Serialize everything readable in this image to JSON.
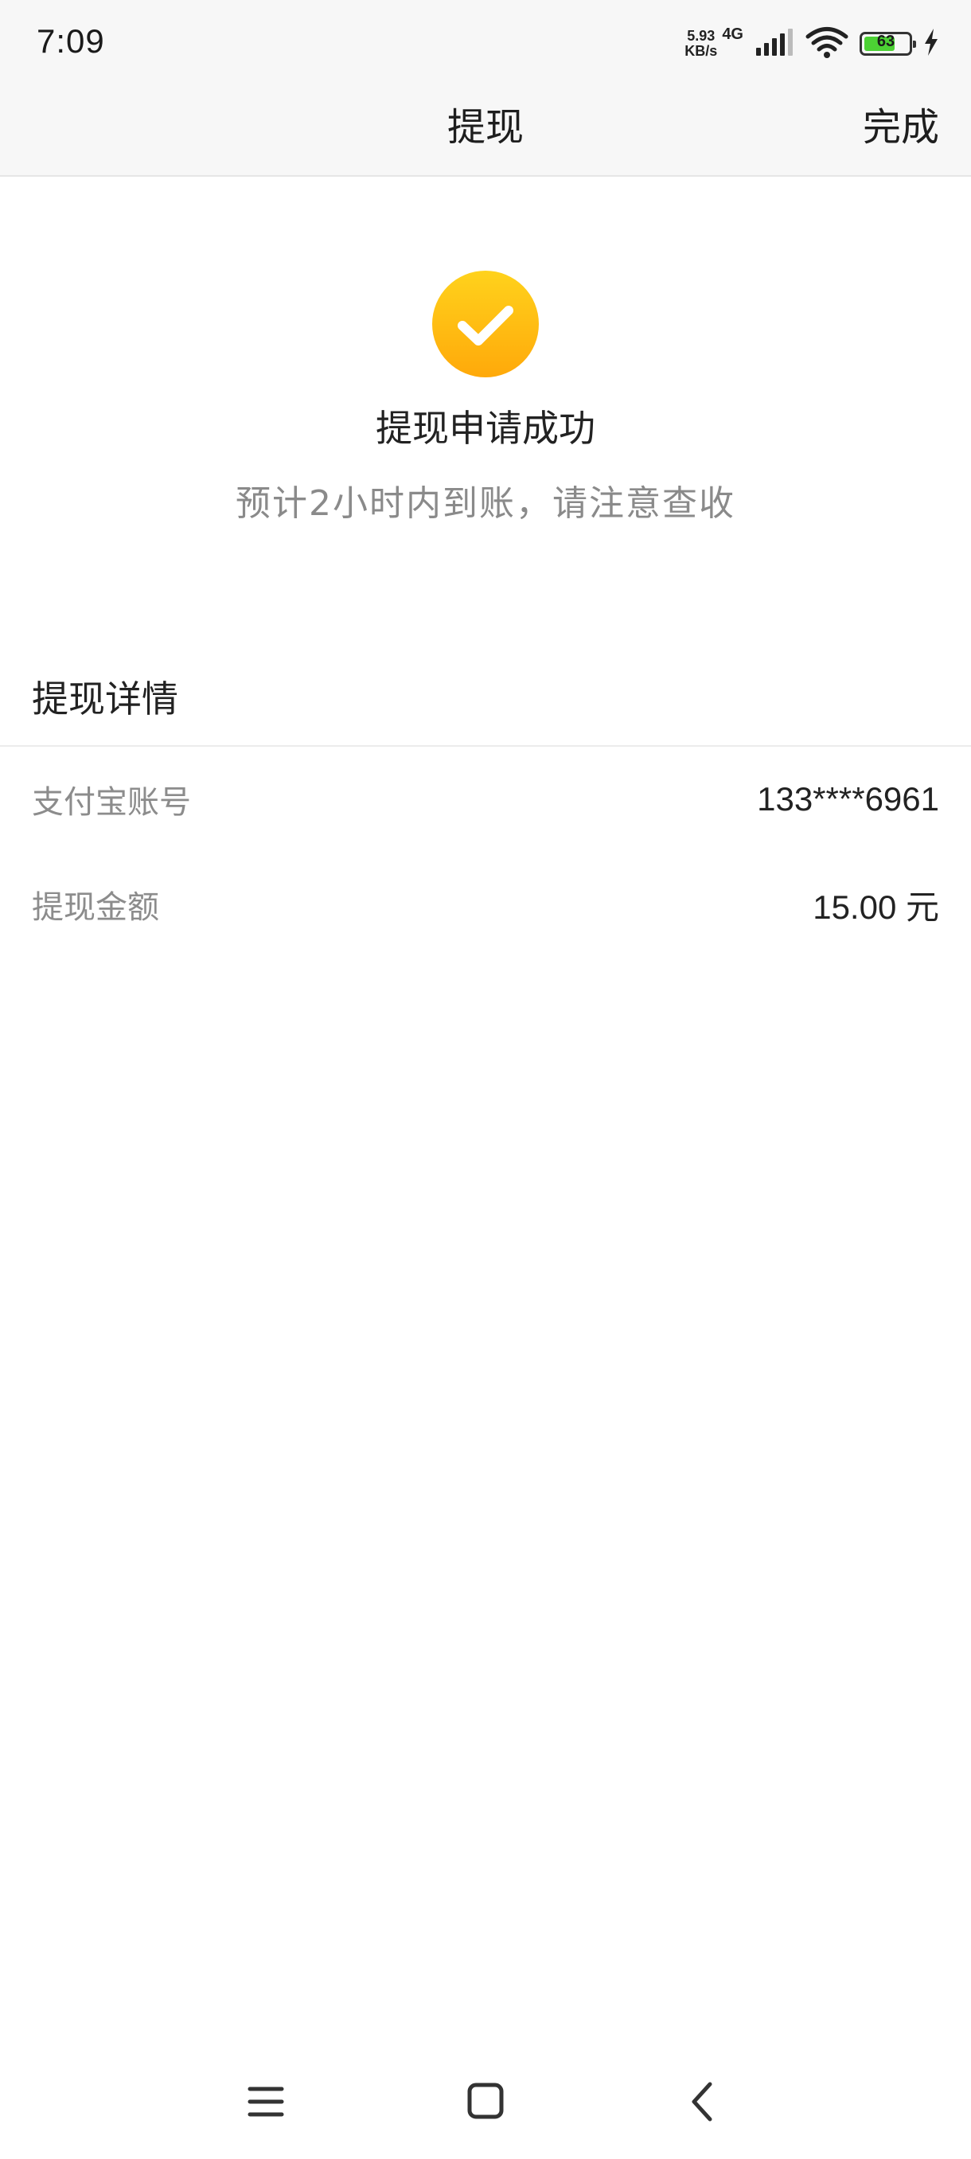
{
  "status_bar": {
    "time": "7:09",
    "net_speed_value": "5.93",
    "net_speed_unit": "KB/s",
    "network_type": "4G",
    "battery_level": "63",
    "battery_color": "#4cd134",
    "icons": [
      "signal-icon",
      "wifi-icon",
      "battery-icon",
      "charging-icon"
    ]
  },
  "navbar": {
    "title": "提现",
    "done_label": "完成"
  },
  "result": {
    "icon": "check-circle-icon",
    "icon_color": "#ffb812",
    "title": "提现申请成功",
    "subtitle": "预计2小时内到账，请注意查收"
  },
  "details": {
    "header": "提现详情",
    "rows": [
      {
        "label": "支付宝账号",
        "value": "133****6961"
      },
      {
        "label": "提现金额",
        "value": "15.00 元"
      }
    ]
  },
  "system_nav": {
    "icons": [
      "menu-icon",
      "home-icon",
      "back-icon"
    ]
  }
}
